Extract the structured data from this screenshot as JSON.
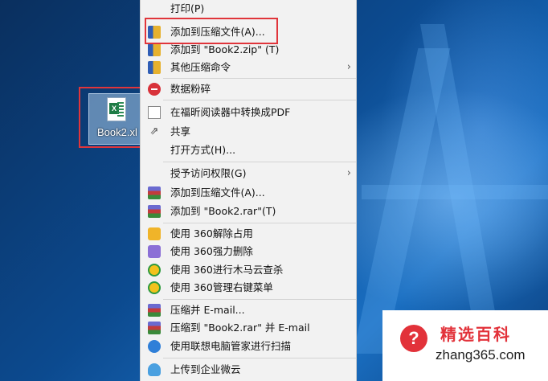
{
  "desktop_icon": {
    "label": "Book2.xl"
  },
  "menu": {
    "items": [
      {
        "label": "打印(P)",
        "icon": "none",
        "submenu": false
      },
      {
        "label": "添加到压缩文件(A)...",
        "icon": "zip-box-icon",
        "submenu": false
      },
      {
        "label": "添加到 \"Book2.zip\" (T)",
        "icon": "zip-box-icon",
        "submenu": false
      },
      {
        "label": "其他压缩命令",
        "icon": "zip-box-icon",
        "submenu": true
      },
      {
        "label": "数据粉碎",
        "icon": "shred-icon",
        "submenu": false
      },
      {
        "label": "在福昕阅读器中转换成PDF",
        "icon": "pdf-convert-icon",
        "submenu": false
      },
      {
        "label": "共享",
        "icon": "share-icon",
        "submenu": false
      },
      {
        "label": "打开方式(H)...",
        "icon": "none",
        "submenu": false
      },
      {
        "label": "授予访问权限(G)",
        "icon": "none",
        "submenu": true
      },
      {
        "label": "添加到压缩文件(A)...",
        "icon": "winrar-icon",
        "submenu": false
      },
      {
        "label": "添加到 \"Book2.rar\"(T)",
        "icon": "winrar-icon",
        "submenu": false
      },
      {
        "label": "使用 360解除占用",
        "icon": "360-unlock-icon",
        "submenu": false
      },
      {
        "label": "使用 360强力删除",
        "icon": "360-delete-icon",
        "submenu": false
      },
      {
        "label": "使用 360进行木马云查杀",
        "icon": "360-scan-icon",
        "submenu": false
      },
      {
        "label": "使用 360管理右键菜单",
        "icon": "360-menu-icon",
        "submenu": false
      },
      {
        "label": "压缩并 E-mail...",
        "icon": "winrar-icon",
        "submenu": false
      },
      {
        "label": "压缩到 \"Book2.rar\" 并 E-mail",
        "icon": "winrar-icon",
        "submenu": false
      },
      {
        "label": "使用联想电脑管家进行扫描",
        "icon": "lenovo-scan-icon",
        "submenu": false
      },
      {
        "label": "上传到企业微云",
        "icon": "cloud-upload-icon",
        "submenu": false
      }
    ],
    "submenu_arrow": "›"
  },
  "watermark": {
    "title": "精选百科",
    "url": "zhang365.com",
    "badge": "?"
  },
  "colors": {
    "highlight": "#e0353b",
    "menu_bg": "#f2f2f2",
    "brand_red": "#e2323a"
  }
}
